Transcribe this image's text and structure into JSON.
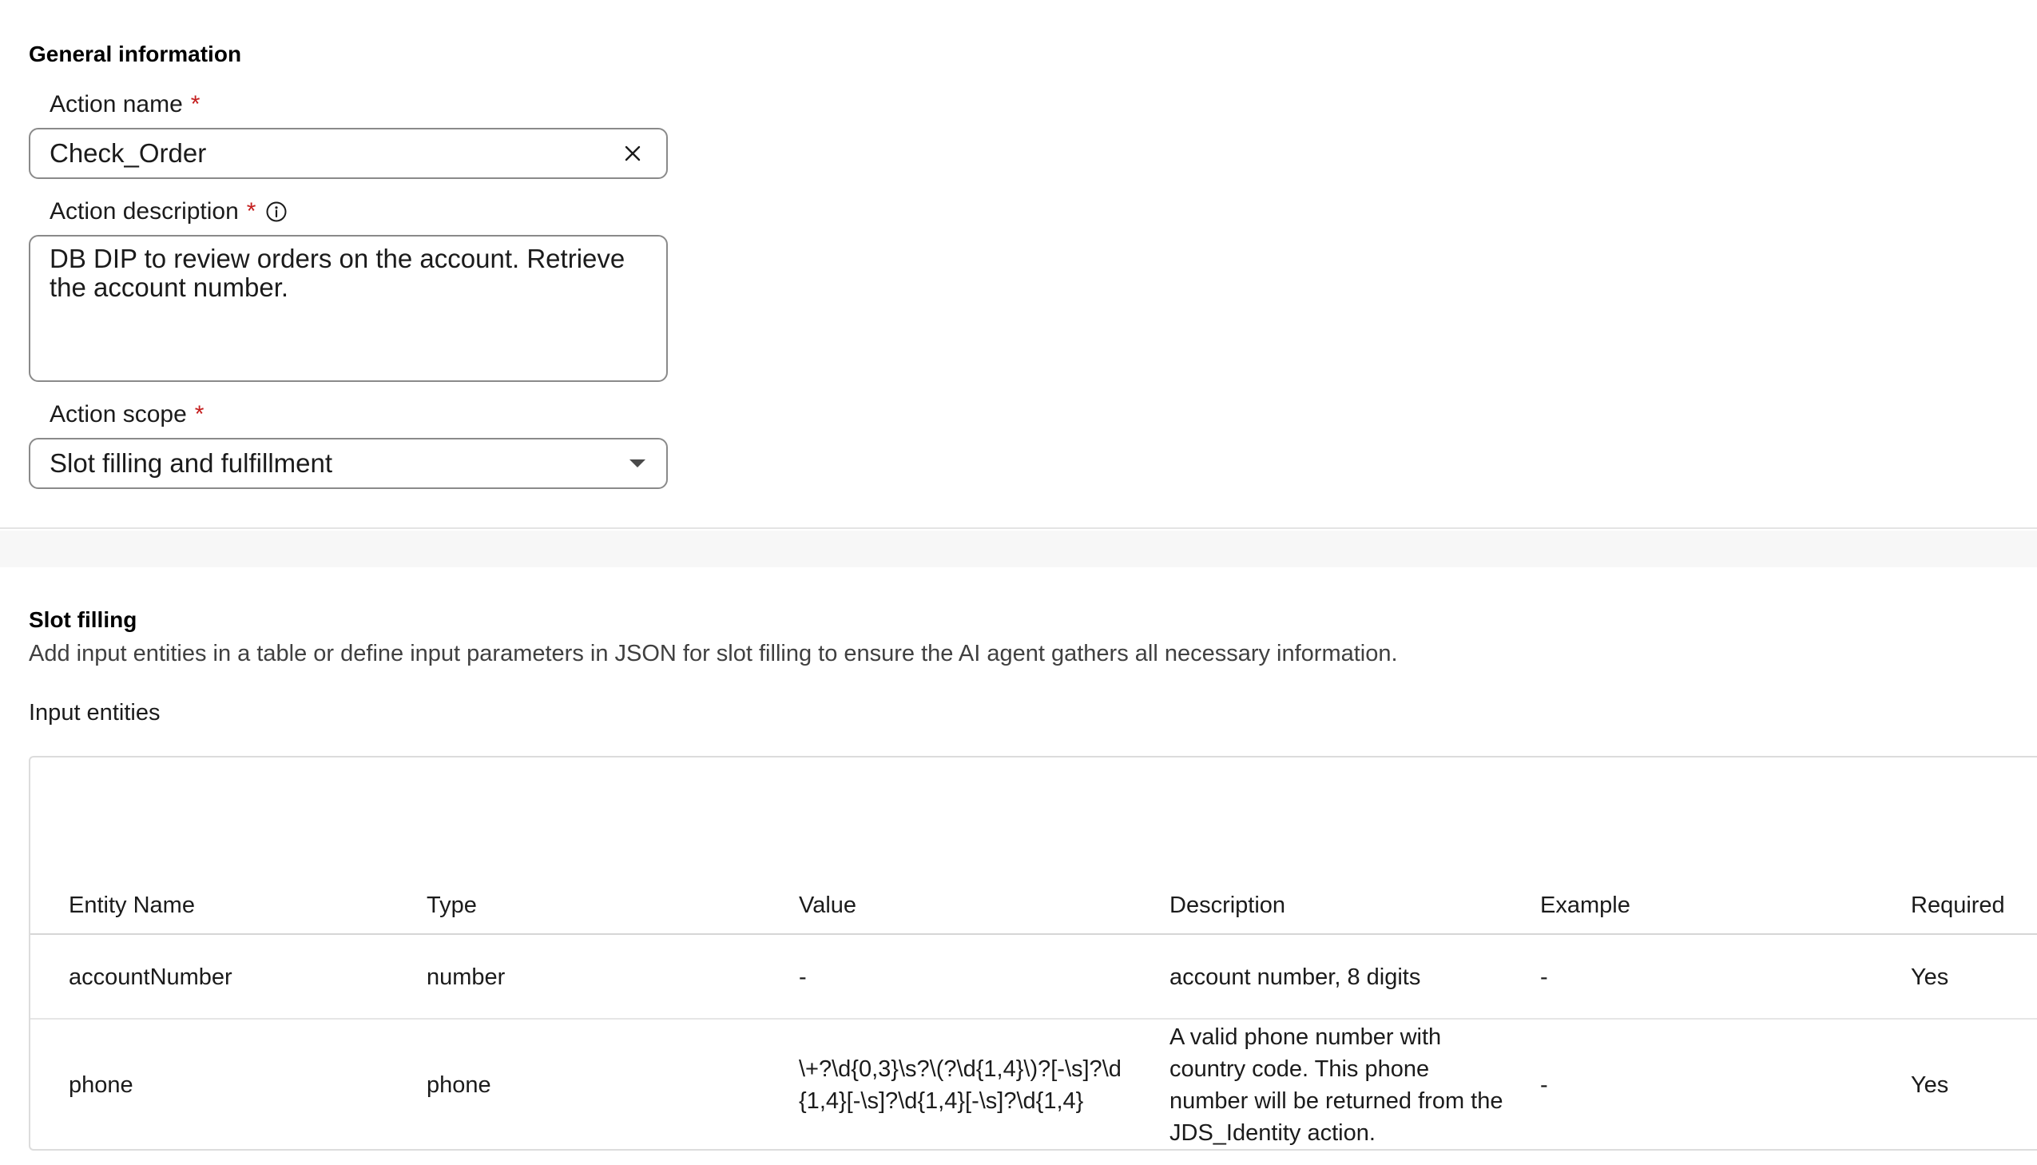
{
  "general": {
    "title": "General information",
    "action_name": {
      "label": "Action name",
      "required_mark": "*",
      "value": "Check_Order"
    },
    "action_description": {
      "label": "Action description",
      "required_mark": "*",
      "value": "DB DIP to review orders on the account. Retrieve the account number."
    },
    "action_scope": {
      "label": "Action scope",
      "required_mark": "*",
      "selected": "Slot filling and fulfillment"
    }
  },
  "slot_filling": {
    "title": "Slot filling",
    "description": "Add input entities in a table or define input parameters in JSON for slot filling to ensure the AI agent gathers all necessary information.",
    "input_entities_label": "Input entities",
    "table": {
      "columns": [
        "Entity Name",
        "Type",
        "Value",
        "Description",
        "Example",
        "Required"
      ],
      "rows": [
        {
          "entity_name": "accountNumber",
          "type": "number",
          "value": "-",
          "description": "account number, 8 digits",
          "example": "-",
          "required": "Yes"
        },
        {
          "entity_name": "phone",
          "type": "phone",
          "value": "\\+?\\d{0,3}\\s?\\(?\\d{1,4}\\)?[-\\s]?\\d{1,4}[-\\s]?\\d{1,4}[-\\s]?\\d{1,4}",
          "description": "A valid phone number with country code. This phone number will be returned from the JDS_Identity action.",
          "example": "-",
          "required": "Yes"
        }
      ]
    }
  },
  "colors": {
    "required": "#c41e1e",
    "border": "#8a8a8a",
    "band": "#f7f7f7"
  },
  "icons": {
    "clear": "close-icon",
    "info": "info-icon",
    "dropdown": "chevron-down-icon"
  }
}
